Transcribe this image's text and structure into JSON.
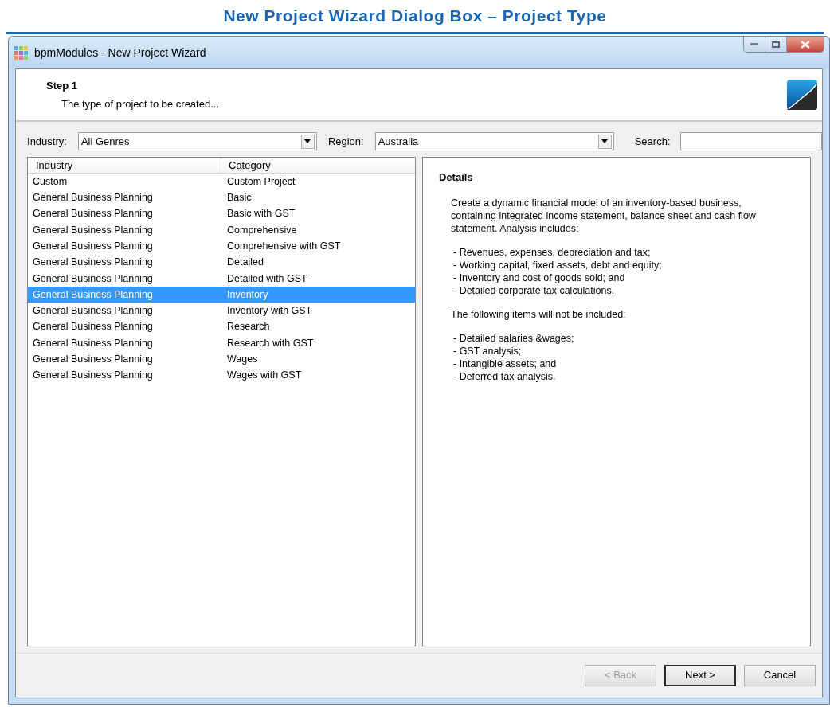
{
  "page_title": "New Project Wizard Dialog Box – Project Type",
  "window": {
    "title": "bpmModules - New Project Wizard"
  },
  "header": {
    "step": "Step 1",
    "subtitle": "The type of project to be created..."
  },
  "filters": [
    {
      "kind": "dropdown",
      "label": "Industry:",
      "mnemonic": true,
      "value": "All Genres"
    },
    {
      "kind": "dropdown",
      "label": "Region:",
      "mnemonic": true,
      "value": "Australia"
    },
    {
      "kind": "text",
      "label": "Search:",
      "mnemonic": true
    }
  ],
  "table": {
    "columns": [
      "Industry",
      "Category"
    ],
    "rows": [
      {
        "cells": [
          "Custom",
          "Custom Project"
        ],
        "selected": false
      },
      {
        "cells": [
          "General Business Planning",
          "Basic"
        ],
        "selected": false
      },
      {
        "cells": [
          "General Business Planning",
          "Basic with GST"
        ],
        "selected": false
      },
      {
        "cells": [
          "General Business Planning",
          "Comprehensive"
        ],
        "selected": false
      },
      {
        "cells": [
          "General Business Planning",
          "Comprehensive with GST"
        ],
        "selected": false
      },
      {
        "cells": [
          "General Business Planning",
          "Detailed"
        ],
        "selected": false
      },
      {
        "cells": [
          "General Business Planning",
          "Detailed with GST"
        ],
        "selected": false
      },
      {
        "cells": [
          "General Business Planning",
          "Inventory"
        ],
        "selected": true
      },
      {
        "cells": [
          "General Business Planning",
          "Inventory with GST"
        ],
        "selected": false
      },
      {
        "cells": [
          "General Business Planning",
          "Research"
        ],
        "selected": false
      },
      {
        "cells": [
          "General Business Planning",
          "Research with GST"
        ],
        "selected": false
      },
      {
        "cells": [
          "General Business Planning",
          "Wages"
        ],
        "selected": false
      },
      {
        "cells": [
          "General Business Planning",
          "Wages with GST"
        ],
        "selected": false
      }
    ]
  },
  "details": {
    "heading": "Details",
    "paragraphs": [
      {
        "kind": "text",
        "lines": [
          "Create a dynamic financial model of an inventory-based business,",
          "containing integrated income statement, balance sheet and cash flow",
          "statement. Analysis includes:"
        ]
      },
      {
        "kind": "list",
        "lines": [
          "- Revenues, expenses, depreciation and tax;",
          "- Working capital, fixed assets, debt and equity;",
          "- Inventory and cost of goods sold; and",
          "- Detailed corporate tax calculations."
        ]
      },
      {
        "kind": "text",
        "lines": [
          "The following items will not be included:"
        ]
      },
      {
        "kind": "list",
        "lines": [
          "- Detailed salaries &wages;",
          "- GST analysis;",
          "- Intangible assets; and",
          "- Deferred tax analysis."
        ]
      }
    ]
  },
  "buttons": [
    {
      "label": "< Back",
      "disabled": true,
      "default": false
    },
    {
      "label": "Next >",
      "disabled": false,
      "default": true
    },
    {
      "label": "Cancel",
      "disabled": false,
      "default": false
    }
  ]
}
